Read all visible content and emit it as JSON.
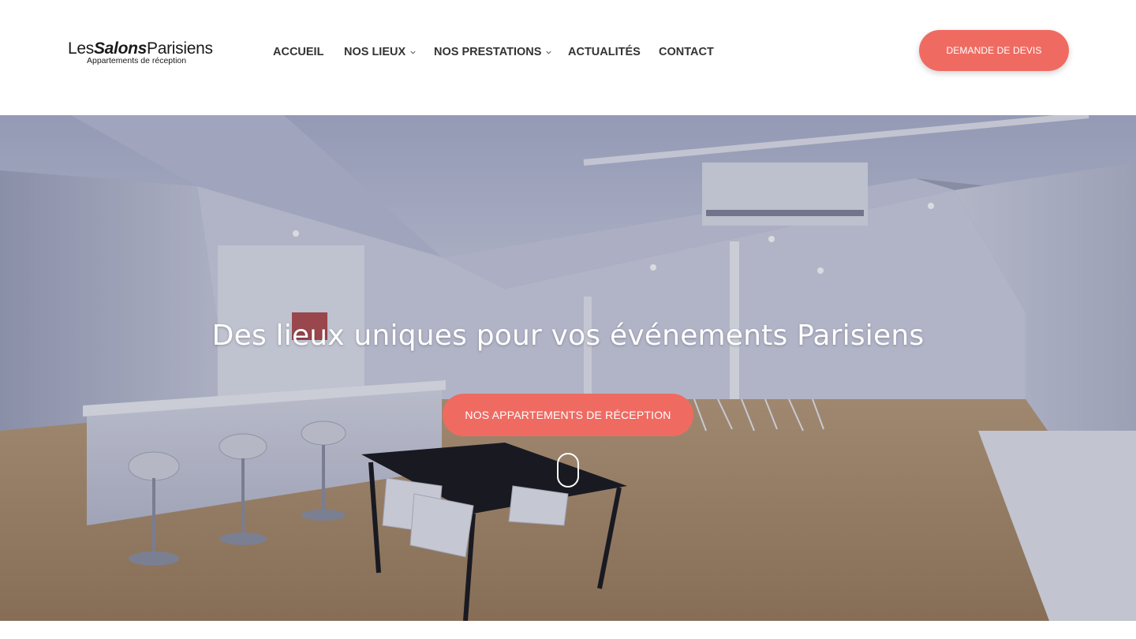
{
  "brand": {
    "logo_word1": "Les",
    "logo_word2": "Salons",
    "logo_word3": "Parisiens",
    "logo_tagline": "Appartements de réception"
  },
  "nav": {
    "items": [
      {
        "label": "ACCUEIL",
        "has_dropdown": false
      },
      {
        "label": "NOS LIEUX",
        "has_dropdown": true
      },
      {
        "label": "NOS PRESTATIONS",
        "has_dropdown": true
      },
      {
        "label": "ACTUALITÉS",
        "has_dropdown": false
      },
      {
        "label": "CONTACT",
        "has_dropdown": false
      }
    ],
    "dropdown_icon": "chevron-down-icon"
  },
  "header": {
    "cta_label": "DEMANDE DE DEVIS"
  },
  "hero": {
    "title": "Des lieux uniques pour vos événements Parisiens",
    "cta_label": "NOS APPARTEMENTS DE RÉCEPTION",
    "scroll_icon": "mouse-scroll-icon",
    "background": "reception-room-photo"
  },
  "colors": {
    "accent": "#ef6b62",
    "nav_text": "#333333",
    "header_bg": "#ffffff",
    "hero_text": "#ffffff"
  }
}
